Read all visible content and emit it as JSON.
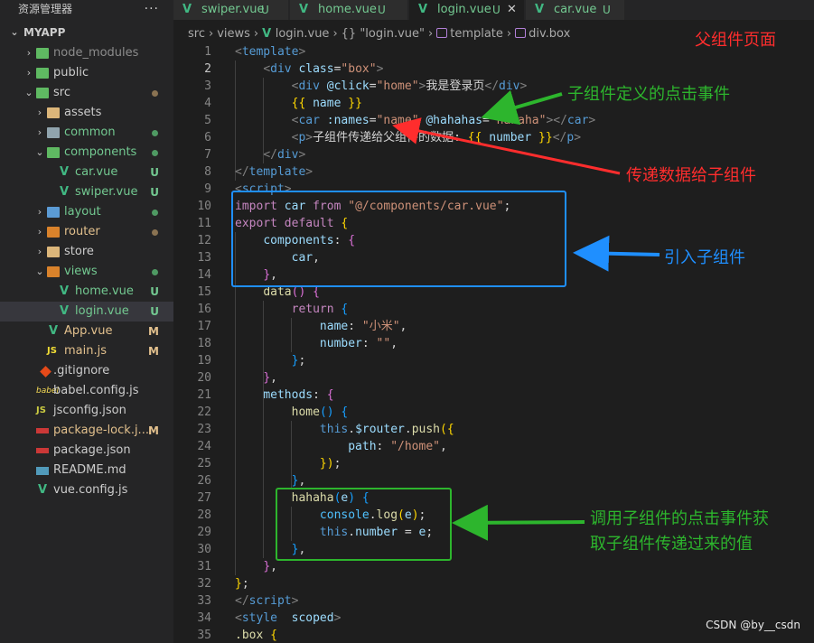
{
  "sidebar": {
    "title": "资源管理器",
    "more": "···",
    "root": "MYAPP",
    "items": [
      {
        "label": "node_modules",
        "chev": "›",
        "icon": "folder-node-icon",
        "color": "dim",
        "status": ""
      },
      {
        "label": "public",
        "chev": "›",
        "icon": "folder-public-icon",
        "color": "norm",
        "status": ""
      },
      {
        "label": "src",
        "chev": "⌄",
        "icon": "folder-src-icon",
        "color": "norm",
        "status": "dot-mod"
      },
      {
        "label": "assets",
        "chev": "›",
        "icon": "folder-assets-icon",
        "color": "norm",
        "status": ""
      },
      {
        "label": "common",
        "chev": "›",
        "icon": "folder-common-icon",
        "color": "green",
        "status": "dot-green"
      },
      {
        "label": "components",
        "chev": "⌄",
        "icon": "folder-components-icon",
        "color": "green",
        "status": "dot-green"
      },
      {
        "label": "car.vue",
        "chev": "",
        "icon": "vue-file-icon",
        "color": "green",
        "status": "U"
      },
      {
        "label": "swiper.vue",
        "chev": "",
        "icon": "vue-file-icon",
        "color": "green",
        "status": "U"
      },
      {
        "label": "layout",
        "chev": "›",
        "icon": "folder-layout-icon",
        "color": "green",
        "status": "dot-green"
      },
      {
        "label": "router",
        "chev": "›",
        "icon": "folder-router-icon",
        "color": "mod",
        "status": "dot-mod"
      },
      {
        "label": "store",
        "chev": "›",
        "icon": "folder-store-icon",
        "color": "norm",
        "status": ""
      },
      {
        "label": "views",
        "chev": "⌄",
        "icon": "folder-views-icon",
        "color": "green",
        "status": "dot-green"
      },
      {
        "label": "home.vue",
        "chev": "",
        "icon": "vue-file-icon",
        "color": "green",
        "status": "U"
      },
      {
        "label": "login.vue",
        "chev": "",
        "icon": "vue-file-icon",
        "color": "green",
        "status": "U"
      },
      {
        "label": "App.vue",
        "chev": "",
        "icon": "vue-file-icon",
        "color": "mod",
        "status": "M"
      },
      {
        "label": "main.js",
        "chev": "",
        "icon": "js-file-icon",
        "color": "mod",
        "status": "M"
      },
      {
        "label": ".gitignore",
        "chev": "",
        "icon": "git-file-icon",
        "color": "norm",
        "status": ""
      },
      {
        "label": "babel.config.js",
        "chev": "",
        "icon": "babel-file-icon",
        "color": "norm",
        "status": ""
      },
      {
        "label": "jsconfig.json",
        "chev": "",
        "icon": "js-file-icon",
        "color": "norm",
        "status": ""
      },
      {
        "label": "package-lock.j...",
        "chev": "",
        "icon": "npm-file-icon",
        "color": "mod",
        "status": "M"
      },
      {
        "label": "package.json",
        "chev": "",
        "icon": "npm-file-icon",
        "color": "norm",
        "status": ""
      },
      {
        "label": "README.md",
        "chev": "",
        "icon": "readme-file-icon",
        "color": "norm",
        "status": ""
      },
      {
        "label": "vue.config.js",
        "chev": "",
        "icon": "vue-file-icon",
        "color": "norm",
        "status": ""
      }
    ]
  },
  "tabs": [
    {
      "label": "swiper.vue",
      "badge": "U",
      "close": ""
    },
    {
      "label": "home.vue",
      "badge": "U",
      "close": ""
    },
    {
      "label": "login.vue",
      "badge": "U",
      "close": "✕"
    },
    {
      "label": "car.vue",
      "badge": "U",
      "close": ""
    }
  ],
  "breadcrumb": {
    "src": "src",
    "views": "views",
    "file": "login.vue",
    "obj": "{} \"login.vue\"",
    "tpl": "template",
    "div": "div.box",
    "sep": "›"
  },
  "editor": {
    "current_line": 2,
    "lines": [
      {
        "n": "1",
        "tokens": [
          [
            "t-br",
            "<"
          ],
          [
            "t-tag",
            "template"
          ],
          [
            "t-br",
            ">"
          ]
        ]
      },
      {
        "n": "2",
        "tokens": [
          [
            "t-text",
            "    "
          ],
          [
            "t-br",
            "<"
          ],
          [
            "t-tag",
            "div"
          ],
          [
            "t-text",
            " "
          ],
          [
            "t-attr",
            "class"
          ],
          [
            "t-text",
            "="
          ],
          [
            "t-str",
            "\"box\""
          ],
          [
            "t-br",
            ">"
          ]
        ]
      },
      {
        "n": "3",
        "tokens": [
          [
            "t-text",
            "        "
          ],
          [
            "t-br",
            "<"
          ],
          [
            "t-tag",
            "div"
          ],
          [
            "t-text",
            " "
          ],
          [
            "t-attr",
            "@click"
          ],
          [
            "t-text",
            "="
          ],
          [
            "t-str",
            "\"home\""
          ],
          [
            "t-br",
            ">"
          ],
          [
            "t-text",
            "我是登录页"
          ],
          [
            "t-br",
            "</"
          ],
          [
            "t-tag",
            "div"
          ],
          [
            "t-br",
            ">"
          ]
        ]
      },
      {
        "n": "4",
        "tokens": [
          [
            "t-text",
            "        "
          ],
          [
            "t-br1",
            "{{"
          ],
          [
            "t-text",
            " "
          ],
          [
            "t-prop",
            "name"
          ],
          [
            "t-text",
            " "
          ],
          [
            "t-br1",
            "}}"
          ]
        ]
      },
      {
        "n": "5",
        "tokens": [
          [
            "t-text",
            "        "
          ],
          [
            "t-br",
            "<"
          ],
          [
            "t-tag",
            "car"
          ],
          [
            "t-text",
            " "
          ],
          [
            "t-attr",
            ":names"
          ],
          [
            "t-text",
            "="
          ],
          [
            "t-str",
            "\"name\""
          ],
          [
            "t-text",
            " "
          ],
          [
            "t-attr",
            "@hahahas"
          ],
          [
            "t-text",
            "="
          ],
          [
            "t-str",
            "\"hahaha\""
          ],
          [
            "t-br",
            "></"
          ],
          [
            "t-tag",
            "car"
          ],
          [
            "t-br",
            ">"
          ]
        ]
      },
      {
        "n": "6",
        "tokens": [
          [
            "t-text",
            "        "
          ],
          [
            "t-br",
            "<"
          ],
          [
            "t-tag",
            "p"
          ],
          [
            "t-br",
            ">"
          ],
          [
            "t-text",
            "子组件传递给父组件的数据: "
          ],
          [
            "t-br1",
            "{{"
          ],
          [
            "t-text",
            " "
          ],
          [
            "t-prop",
            "number"
          ],
          [
            "t-text",
            " "
          ],
          [
            "t-br1",
            "}}"
          ],
          [
            "t-br",
            "</"
          ],
          [
            "t-tag",
            "p"
          ],
          [
            "t-br",
            ">"
          ]
        ]
      },
      {
        "n": "7",
        "tokens": [
          [
            "t-text",
            "    "
          ],
          [
            "t-br",
            "</"
          ],
          [
            "t-tag",
            "div"
          ],
          [
            "t-br",
            ">"
          ]
        ]
      },
      {
        "n": "8",
        "tokens": [
          [
            "t-br",
            "</"
          ],
          [
            "t-tag",
            "template"
          ],
          [
            "t-br",
            ">"
          ]
        ]
      },
      {
        "n": "9",
        "tokens": [
          [
            "t-br",
            "<"
          ],
          [
            "t-tag",
            "script"
          ],
          [
            "t-br",
            ">"
          ]
        ]
      },
      {
        "n": "10",
        "tokens": [
          [
            "t-kw",
            "import"
          ],
          [
            "t-text",
            " "
          ],
          [
            "t-prop",
            "car"
          ],
          [
            "t-text",
            " "
          ],
          [
            "t-kw",
            "from"
          ],
          [
            "t-text",
            " "
          ],
          [
            "t-str",
            "\"@/components/car.vue\""
          ],
          [
            "t-punc",
            ";"
          ]
        ]
      },
      {
        "n": "11",
        "tokens": [
          [
            "t-kw",
            "export"
          ],
          [
            "t-text",
            " "
          ],
          [
            "t-kw",
            "default"
          ],
          [
            "t-text",
            " "
          ],
          [
            "t-br1",
            "{"
          ]
        ]
      },
      {
        "n": "12",
        "tokens": [
          [
            "t-text",
            "    "
          ],
          [
            "t-prop",
            "components"
          ],
          [
            "t-punc",
            ": "
          ],
          [
            "t-br2",
            "{"
          ]
        ]
      },
      {
        "n": "13",
        "tokens": [
          [
            "t-text",
            "        "
          ],
          [
            "t-prop",
            "car"
          ],
          [
            "t-punc",
            ","
          ]
        ]
      },
      {
        "n": "14",
        "tokens": [
          [
            "t-text",
            "    "
          ],
          [
            "t-br2",
            "}"
          ],
          [
            "t-punc",
            ","
          ]
        ]
      },
      {
        "n": "15",
        "tokens": [
          [
            "t-text",
            "    "
          ],
          [
            "t-fn",
            "data"
          ],
          [
            "t-br2",
            "()"
          ],
          [
            "t-text",
            " "
          ],
          [
            "t-br2",
            "{"
          ]
        ]
      },
      {
        "n": "16",
        "tokens": [
          [
            "t-text",
            "        "
          ],
          [
            "t-kw",
            "return"
          ],
          [
            "t-text",
            " "
          ],
          [
            "t-br3",
            "{"
          ]
        ]
      },
      {
        "n": "17",
        "tokens": [
          [
            "t-text",
            "            "
          ],
          [
            "t-prop",
            "name"
          ],
          [
            "t-punc",
            ": "
          ],
          [
            "t-str",
            "\"小米\""
          ],
          [
            "t-punc",
            ","
          ]
        ]
      },
      {
        "n": "18",
        "tokens": [
          [
            "t-text",
            "            "
          ],
          [
            "t-prop",
            "number"
          ],
          [
            "t-punc",
            ": "
          ],
          [
            "t-str",
            "\"\""
          ],
          [
            "t-punc",
            ","
          ]
        ]
      },
      {
        "n": "19",
        "tokens": [
          [
            "t-text",
            "        "
          ],
          [
            "t-br3",
            "}"
          ],
          [
            "t-punc",
            ";"
          ]
        ]
      },
      {
        "n": "20",
        "tokens": [
          [
            "t-text",
            "    "
          ],
          [
            "t-br2",
            "}"
          ],
          [
            "t-punc",
            ","
          ]
        ]
      },
      {
        "n": "21",
        "tokens": [
          [
            "t-text",
            "    "
          ],
          [
            "t-prop",
            "methods"
          ],
          [
            "t-punc",
            ": "
          ],
          [
            "t-br2",
            "{"
          ]
        ]
      },
      {
        "n": "22",
        "tokens": [
          [
            "t-text",
            "        "
          ],
          [
            "t-fn",
            "home"
          ],
          [
            "t-br3",
            "()"
          ],
          [
            "t-text",
            " "
          ],
          [
            "t-br3",
            "{"
          ]
        ]
      },
      {
        "n": "23",
        "tokens": [
          [
            "t-text",
            "            "
          ],
          [
            "t-this",
            "this"
          ],
          [
            "t-punc",
            "."
          ],
          [
            "t-prop",
            "$router"
          ],
          [
            "t-punc",
            "."
          ],
          [
            "t-fn",
            "push"
          ],
          [
            "t-br1",
            "({"
          ]
        ]
      },
      {
        "n": "24",
        "tokens": [
          [
            "t-text",
            "                "
          ],
          [
            "t-prop",
            "path"
          ],
          [
            "t-punc",
            ": "
          ],
          [
            "t-str",
            "\"/home\""
          ],
          [
            "t-punc",
            ","
          ]
        ]
      },
      {
        "n": "25",
        "tokens": [
          [
            "t-text",
            "            "
          ],
          [
            "t-br1",
            "})"
          ],
          [
            "t-punc",
            ";"
          ]
        ]
      },
      {
        "n": "26",
        "tokens": [
          [
            "t-text",
            "        "
          ],
          [
            "t-br3",
            "}"
          ],
          [
            "t-punc",
            ","
          ]
        ]
      },
      {
        "n": "27",
        "tokens": [
          [
            "t-text",
            "        "
          ],
          [
            "t-fn",
            "hahaha"
          ],
          [
            "t-br3",
            "("
          ],
          [
            "t-prop",
            "e"
          ],
          [
            "t-br3",
            ")"
          ],
          [
            "t-text",
            " "
          ],
          [
            "t-br3",
            "{"
          ]
        ]
      },
      {
        "n": "28",
        "tokens": [
          [
            "t-text",
            "            "
          ],
          [
            "t-var",
            "console"
          ],
          [
            "t-punc",
            "."
          ],
          [
            "t-fn",
            "log"
          ],
          [
            "t-br1",
            "("
          ],
          [
            "t-prop",
            "e"
          ],
          [
            "t-br1",
            ")"
          ],
          [
            "t-punc",
            ";"
          ]
        ]
      },
      {
        "n": "29",
        "tokens": [
          [
            "t-text",
            "            "
          ],
          [
            "t-this",
            "this"
          ],
          [
            "t-punc",
            "."
          ],
          [
            "t-prop",
            "number"
          ],
          [
            "t-text",
            " = "
          ],
          [
            "t-prop",
            "e"
          ],
          [
            "t-punc",
            ";"
          ]
        ]
      },
      {
        "n": "30",
        "tokens": [
          [
            "t-text",
            "        "
          ],
          [
            "t-br3",
            "}"
          ],
          [
            "t-punc",
            ","
          ]
        ]
      },
      {
        "n": "31",
        "tokens": [
          [
            "t-text",
            "    "
          ],
          [
            "t-br2",
            "}"
          ],
          [
            "t-punc",
            ","
          ]
        ]
      },
      {
        "n": "32",
        "tokens": [
          [
            "t-br1",
            "}"
          ],
          [
            "t-punc",
            ";"
          ]
        ]
      },
      {
        "n": "33",
        "tokens": [
          [
            "t-br",
            "</"
          ],
          [
            "t-tag",
            "script"
          ],
          [
            "t-br",
            ">"
          ]
        ]
      },
      {
        "n": "34",
        "tokens": [
          [
            "t-br",
            "<"
          ],
          [
            "t-tag",
            "style"
          ],
          [
            "t-text",
            "  "
          ],
          [
            "t-attr",
            "scoped"
          ],
          [
            "t-br",
            ">"
          ]
        ]
      },
      {
        "n": "35",
        "tokens": [
          [
            "t-fn",
            ".box"
          ],
          [
            "t-text",
            " "
          ],
          [
            "t-br1",
            "{"
          ]
        ]
      }
    ]
  },
  "annotations": {
    "parent_page": "父组件页面",
    "child_event": "子组件定义的点击事件",
    "pass_data": "传递数据给子组件",
    "import_child": "引入子组件",
    "call_event_1": "调用子组件的点击事件获",
    "call_event_2": "取子组件传递过来的值",
    "colors": {
      "red": "#ff2d2d",
      "green": "#2db52d",
      "blue": "#1f8fff"
    }
  },
  "watermark": "CSDN @by__csdn"
}
